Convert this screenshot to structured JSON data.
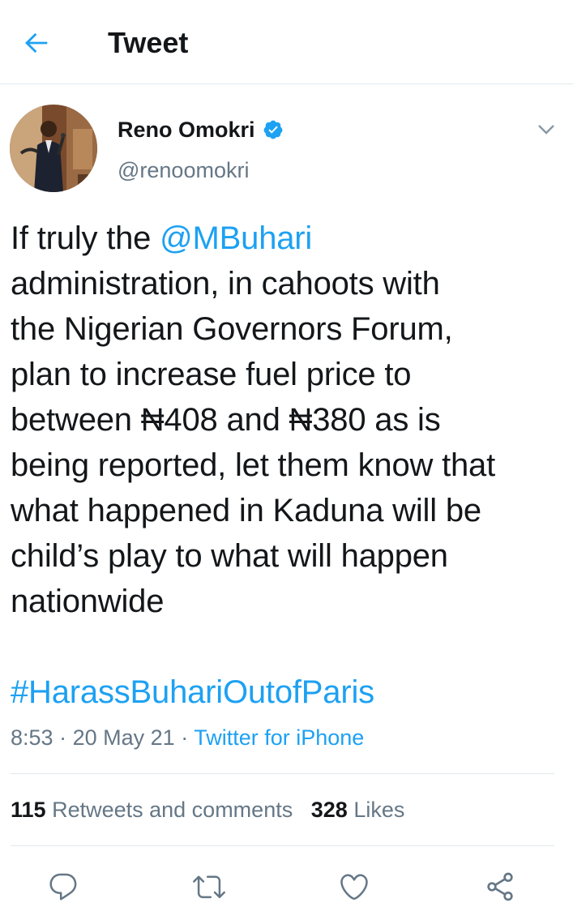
{
  "header": {
    "back_icon": "arrow-left-icon",
    "title": "Tweet"
  },
  "tweet": {
    "author": {
      "name": "Reno Omokri",
      "handle": "@renoomokri",
      "verified": true
    },
    "text": {
      "line1_prefix": "If truly the ",
      "mention": "@MBuhari",
      "line2": "administration, in cahoots with",
      "line3": "the Nigerian Governors Forum,",
      "line4": "plan to increase fuel price to",
      "line5": "between ₦408 and ₦380 as is",
      "line6": "being reported, let them know that",
      "line7": "what happened in Kaduna will be",
      "line8": "child’s play to what will happen",
      "line9": "nationwide"
    },
    "hashtag": "#HarassBuhariOutofParis",
    "time": "8:53",
    "separator": "·",
    "date": "20 May 21",
    "source": "Twitter for iPhone"
  },
  "stats": {
    "retweets_count": "115",
    "retweets_label": "Retweets and comments",
    "likes_count": "328",
    "likes_label": "Likes"
  },
  "actions": [
    "reply-icon",
    "retweet-icon",
    "like-icon",
    "share-icon"
  ],
  "colors": {
    "accent": "#1da1f2",
    "text": "#14171a",
    "secondary": "#657786",
    "divider": "#e1e8ed"
  }
}
